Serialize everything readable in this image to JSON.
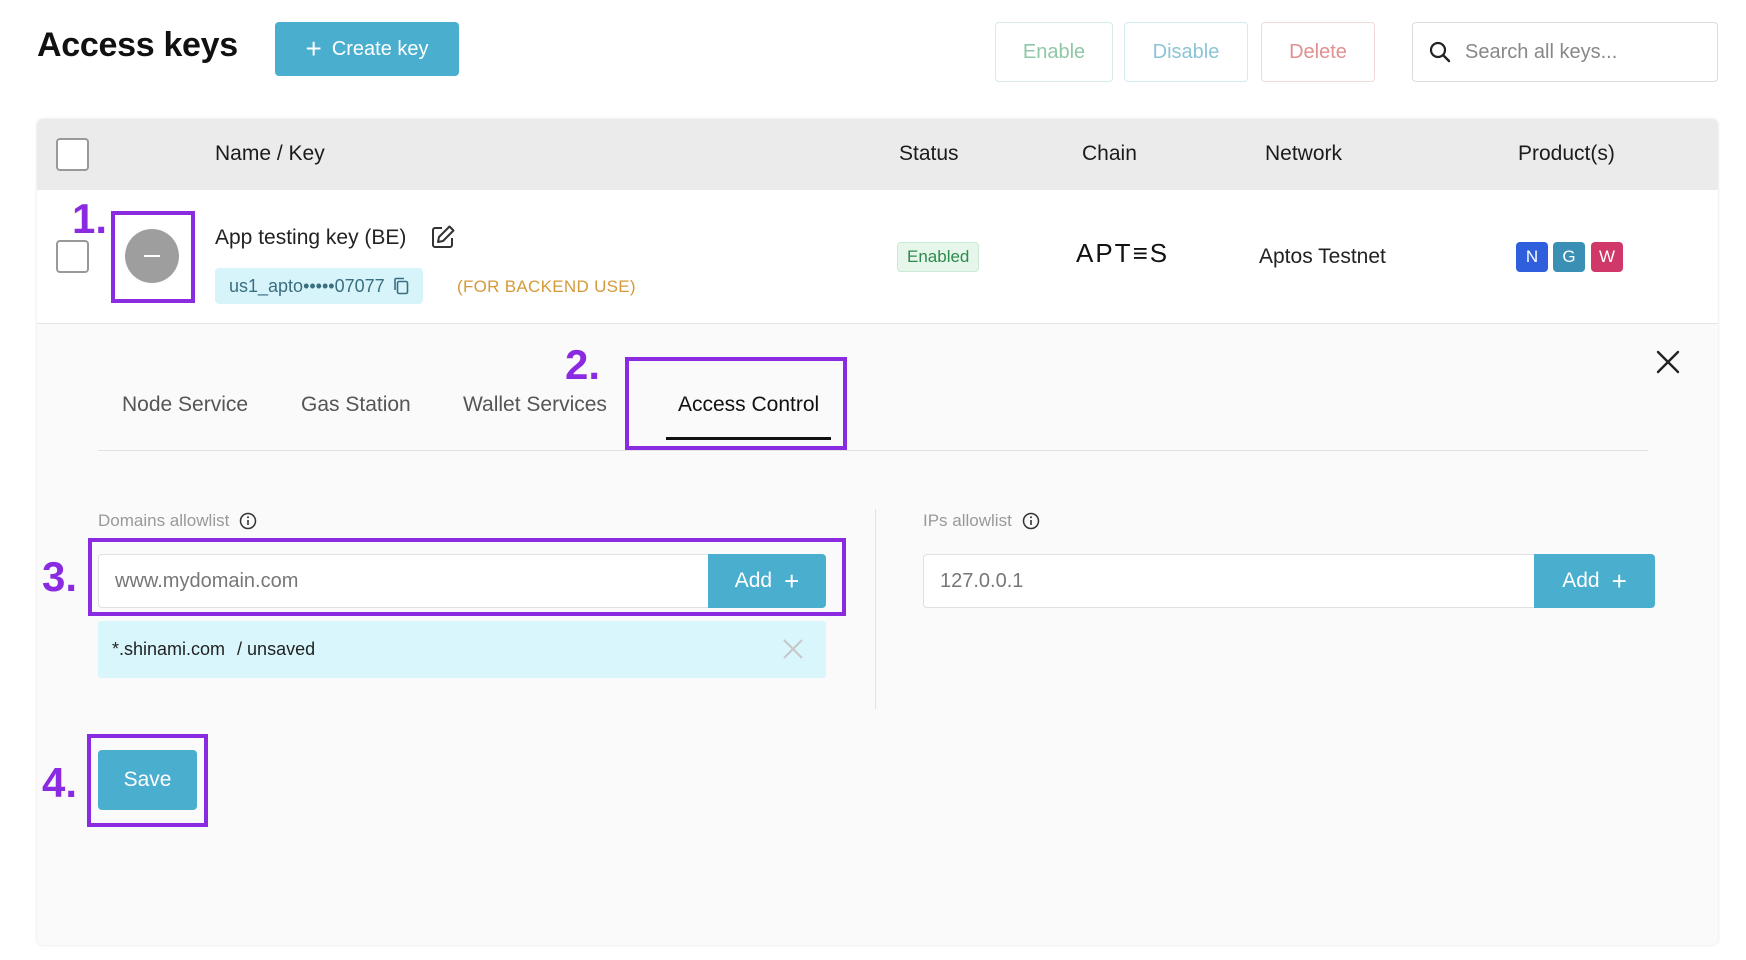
{
  "header": {
    "title": "Access keys",
    "create_label": "Create key",
    "enable_label": "Enable",
    "disable_label": "Disable",
    "delete_label": "Delete",
    "search_placeholder": "Search all keys..."
  },
  "table": {
    "columns": [
      "Name / Key",
      "Status",
      "Chain",
      "Network",
      "Product(s)"
    ],
    "row": {
      "name": "App testing key (BE)",
      "key": "us1_apto•••••07077",
      "note": "(FOR BACKEND USE)",
      "status": "Enabled",
      "chain": "APT≡S",
      "network": "Aptos Testnet",
      "products": [
        "N",
        "G",
        "W"
      ]
    }
  },
  "detail": {
    "tabs": [
      {
        "label": "Node Service"
      },
      {
        "label": "Gas Station"
      },
      {
        "label": "Wallet Services"
      },
      {
        "label": "Access Control",
        "active": true
      }
    ],
    "domains": {
      "label": "Domains allowlist",
      "placeholder": "www.mydomain.com",
      "add_label": "Add",
      "entries": [
        {
          "domain": "*.shinami.com",
          "state": "/ unsaved"
        }
      ]
    },
    "ips": {
      "label": "IPs allowlist",
      "placeholder": "127.0.0.1",
      "add_label": "Add"
    },
    "save_label": "Save"
  },
  "annotations": [
    "1.",
    "2.",
    "3.",
    "4."
  ],
  "colors": {
    "accent": "#4aaecf",
    "annotation": "#8a2be2",
    "enabled_text": "#2e8a4d",
    "product_n": "#2f5fdc",
    "product_g": "#3a8fb5",
    "product_w": "#d0386a"
  }
}
